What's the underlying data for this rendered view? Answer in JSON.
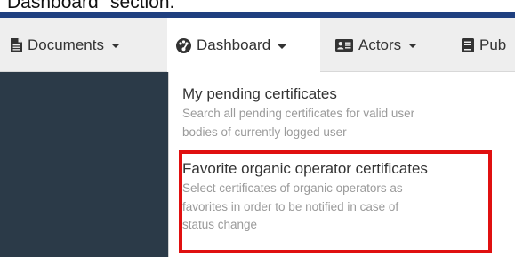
{
  "caption": "Dashboard\" section.",
  "navbar": {
    "items": [
      {
        "label": "Documents",
        "icon": "document-icon"
      },
      {
        "label": "Dashboard",
        "icon": "dashboard-icon"
      },
      {
        "label": "Actors",
        "icon": "id-card-icon"
      },
      {
        "label": "Pub",
        "icon": "book-icon"
      }
    ]
  },
  "dropdown": {
    "entries": [
      {
        "title": "My pending certificates",
        "description_lines": [
          "Search all pending certificates for valid user",
          "bodies of currently logged user"
        ]
      },
      {
        "title": "Favorite organic operator certificates",
        "description_lines": [
          "Select certificates of organic operators as",
          "favorites in order to be notified in case of",
          "status change"
        ]
      }
    ]
  },
  "colors": {
    "brand_blue": "#1f3f7f",
    "navbar_bg": "#eeeeee",
    "sidebar_dark": "#2b3a48",
    "highlight_red": "#e01010",
    "description_gray": "#9a9a9a"
  }
}
